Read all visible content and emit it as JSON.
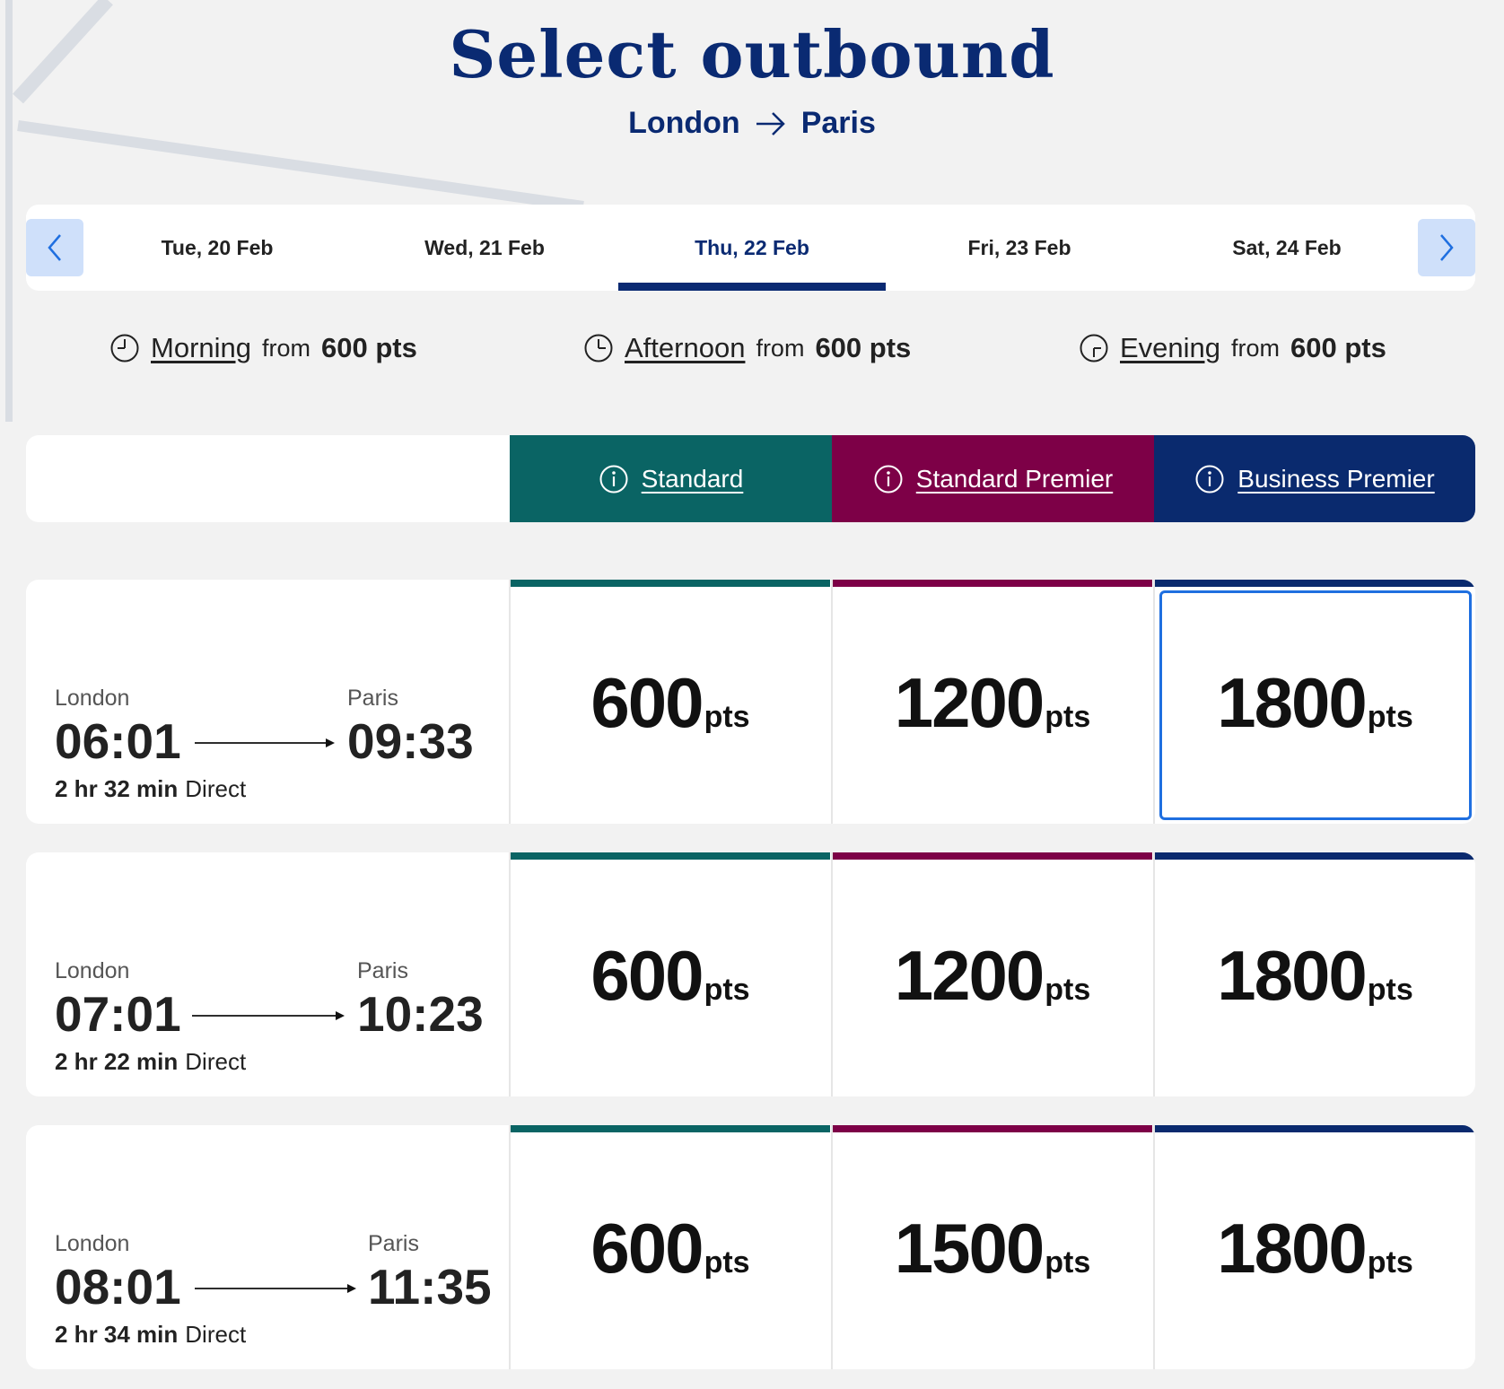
{
  "header": {
    "title": "Select outbound",
    "origin": "London",
    "destination": "Paris"
  },
  "dates": {
    "items": [
      "Tue, 20 Feb",
      "Wed, 21 Feb",
      "Thu, 22 Feb",
      "Fri, 23 Feb",
      "Sat, 24 Feb"
    ],
    "active_index": 2
  },
  "filters": [
    {
      "name": "Morning",
      "from": "from",
      "pts": "600 pts"
    },
    {
      "name": "Afternoon",
      "from": "from",
      "pts": "600 pts"
    },
    {
      "name": "Evening",
      "from": "from",
      "pts": "600 pts"
    }
  ],
  "classes": [
    {
      "label": "Standard",
      "color": "#0a6464"
    },
    {
      "label": "Standard Premier",
      "color": "#7d0047"
    },
    {
      "label": "Business Premier",
      "color": "#0a2a6e"
    }
  ],
  "journeys": [
    {
      "from": "London",
      "to": "Paris",
      "depart": "06:01",
      "arrive": "09:33",
      "duration": "2 hr 32 min",
      "type": "Direct",
      "prices": [
        "600",
        "1200",
        "1800"
      ],
      "selected_index": 2
    },
    {
      "from": "London",
      "to": "Paris",
      "depart": "07:01",
      "arrive": "10:23",
      "duration": "2 hr 22 min",
      "type": "Direct",
      "prices": [
        "600",
        "1200",
        "1800"
      ],
      "selected_index": -1
    },
    {
      "from": "London",
      "to": "Paris",
      "depart": "08:01",
      "arrive": "11:35",
      "duration": "2 hr 34 min",
      "type": "Direct",
      "prices": [
        "600",
        "1500",
        "1800"
      ],
      "selected_index": -1
    }
  ],
  "price_unit": "pts",
  "colors": {
    "brand": "#0a2a72",
    "select_outline": "#1f6fe0",
    "nav_button": "#cfe0fa"
  }
}
